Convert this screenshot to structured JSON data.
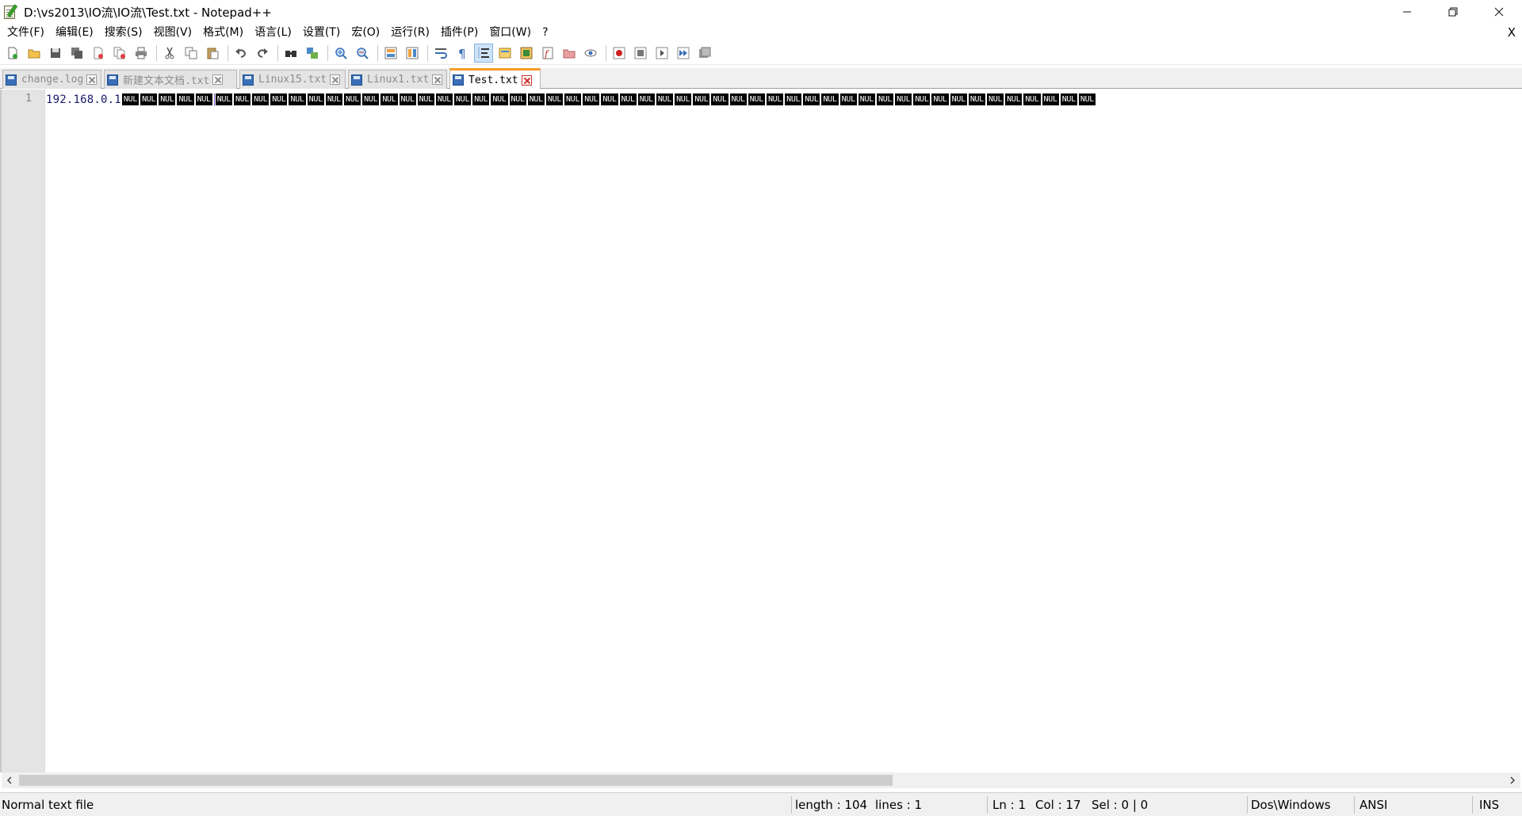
{
  "window": {
    "title": "D:\\vs2013\\IO流\\IO流\\Test.txt - Notepad++",
    "minimize_icon": "minimize-icon",
    "restore_icon": "restore-icon",
    "close_icon": "close-icon"
  },
  "menu": {
    "items": [
      "文件(F)",
      "编辑(E)",
      "搜索(S)",
      "视图(V)",
      "格式(M)",
      "语言(L)",
      "设置(T)",
      "宏(O)",
      "运行(R)",
      "插件(P)",
      "窗口(W)",
      "?"
    ],
    "close_label": "X"
  },
  "toolbar": {
    "icons": [
      "new-file-icon",
      "open-file-icon",
      "save-icon",
      "save-all-icon",
      "close-icon",
      "close-all-icon",
      "print-icon",
      "cut-icon",
      "copy-icon",
      "paste-icon",
      "undo-icon",
      "redo-icon",
      "find-icon",
      "replace-icon",
      "zoom-in-icon",
      "zoom-out-icon",
      "sync-vertical-icon",
      "sync-horizontal-icon",
      "word-wrap-icon",
      "show-all-characters-icon",
      "indent-guide-icon",
      "user-defined-language-icon",
      "document-map-icon",
      "function-list-icon",
      "folder-as-workspace-icon",
      "monitoring-icon",
      "record-macro-icon",
      "stop-record-icon",
      "play-macro-icon",
      "run-macro-multiple-icon",
      "save-macro-icon"
    ],
    "active": "indent-guide-icon"
  },
  "tabs": [
    {
      "label": "change.log",
      "active": false
    },
    {
      "label": "新建文本文档.txt",
      "active": false
    },
    {
      "label": "Linux15.txt",
      "active": false
    },
    {
      "label": "Linux1.txt",
      "active": false
    },
    {
      "label": "Test.txt",
      "active": true
    }
  ],
  "editor": {
    "line_number": "1",
    "text": "192.168.0.1",
    "nul_label": "NUL",
    "nul_count": 53,
    "caret_after_nul": 5
  },
  "statusbar": {
    "file_type": "Normal text file",
    "length": "length : 104",
    "lines": "lines : 1",
    "ln": "Ln : 1",
    "col": "Col : 17",
    "sel": "Sel : 0 | 0",
    "eol": "Dos\\Windows",
    "encoding": "ANSI",
    "mode": "INS"
  },
  "colors": {
    "active_tab_accent": "#fa9b28",
    "text": "#1a1a6e",
    "nul_bg": "#000000"
  }
}
